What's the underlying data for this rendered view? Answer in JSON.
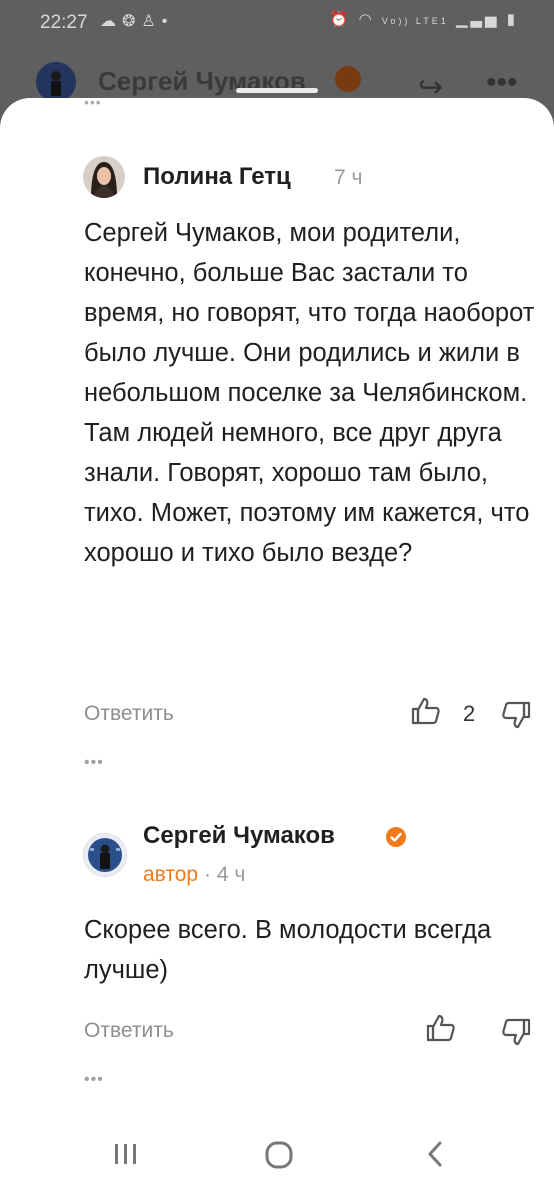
{
  "status_bar": {
    "time": "22:27",
    "left_icons": [
      "cloud-icon",
      "ok-app-icon",
      "ok-person-icon",
      "dot-icon"
    ],
    "right_icons": [
      "alarm-icon",
      "wifi-icon",
      "volte-icon",
      "signal-icon",
      "signal-icon",
      "battery-icon"
    ],
    "network_label": "Vo)) LTE1"
  },
  "background_header": {
    "title": "Сергей Чумаков"
  },
  "comments": [
    {
      "author": "Полина Гетц",
      "time": "7 ч",
      "text": "Сергей Чумаков, мои родители, конечно, больше Вас застали то время, но говорят, что тогда наоборот было лучше. Они родились и жили в небольшом поселке за Челябинском. Там людей немного, все друг друга знали. Говорят, хорошо там было, тихо. Может, поэтому им кажется, что хорошо и тихо было везде?",
      "reply_label": "Ответить",
      "likes": "2",
      "more": "•••"
    },
    {
      "author": "Сергей Чумаков",
      "author_tag": "автор",
      "separator": "·",
      "time": "4 ч",
      "text": "Скорее всего. В молодости всегда лучше)",
      "reply_label": "Ответить",
      "more": "•••"
    }
  ],
  "colors": {
    "accent": "#f07a1a",
    "verified_badge": "#f07a1a",
    "overlay": "#5f5f5f"
  }
}
